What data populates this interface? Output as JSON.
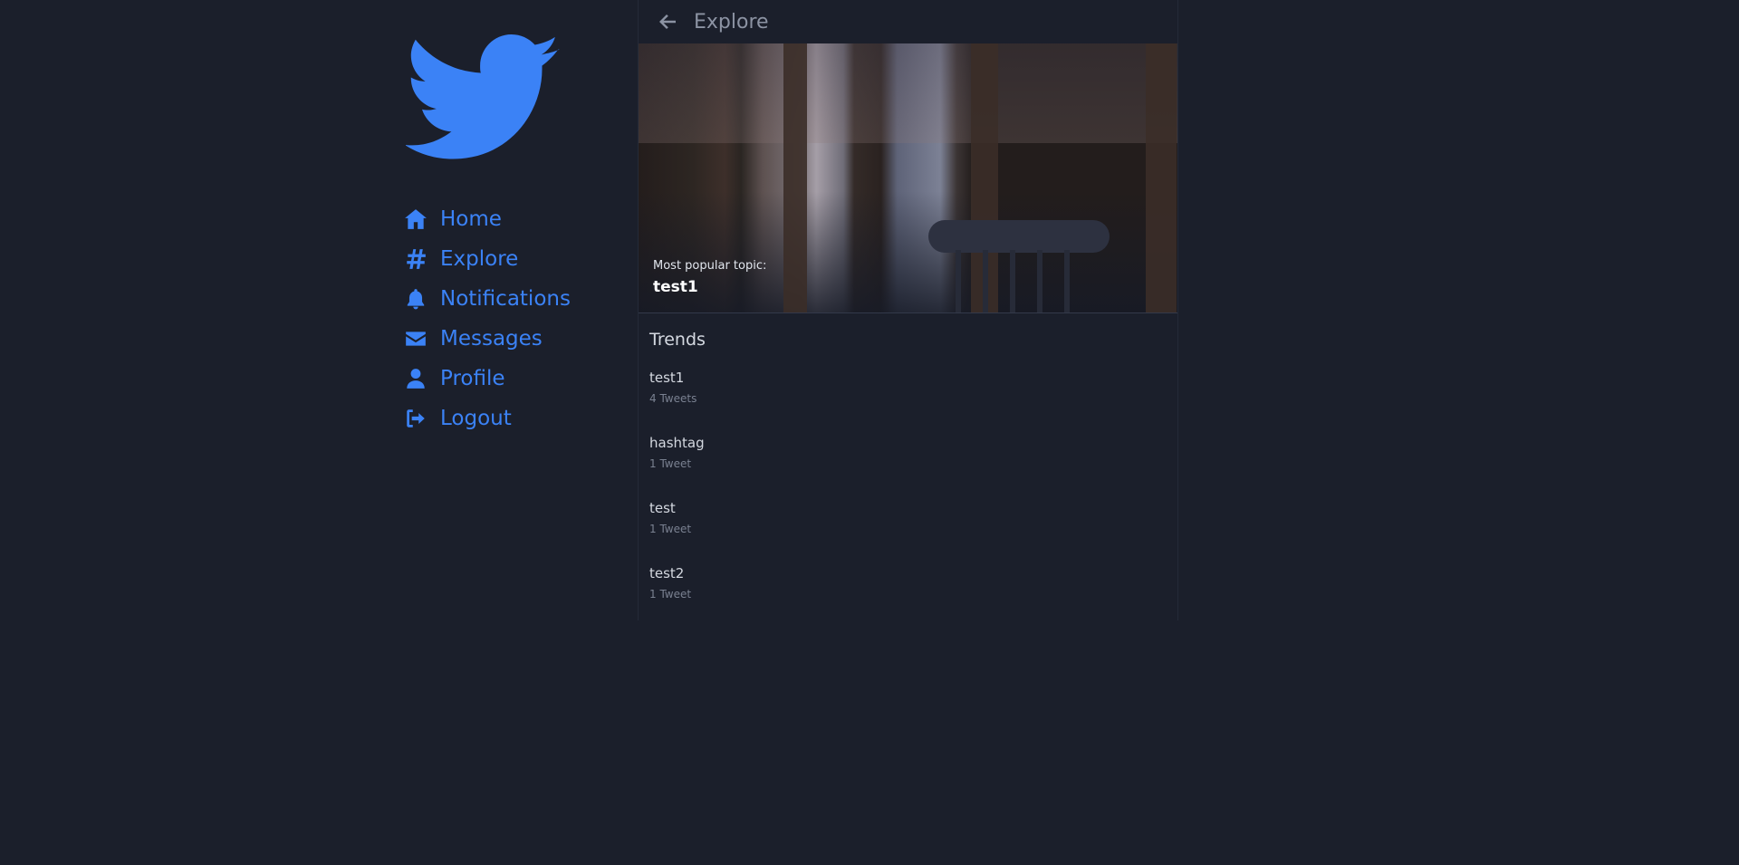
{
  "header": {
    "title": "Explore"
  },
  "sidebar": {
    "items": [
      {
        "label": "Home",
        "icon": "home-icon"
      },
      {
        "label": "Explore",
        "icon": "hashtag-icon"
      },
      {
        "label": "Notifications",
        "icon": "bell-icon"
      },
      {
        "label": "Messages",
        "icon": "envelope-icon"
      },
      {
        "label": "Profile",
        "icon": "user-icon"
      },
      {
        "label": "Logout",
        "icon": "logout-icon"
      }
    ]
  },
  "hero": {
    "label": "Most popular topic:",
    "topic": "test1"
  },
  "trends": {
    "title": "Trends",
    "items": [
      {
        "name": "test1",
        "count": "4 Tweets"
      },
      {
        "name": "hashtag",
        "count": "1 Tweet"
      },
      {
        "name": "test",
        "count": "1 Tweet"
      },
      {
        "name": "test2",
        "count": "1 Tweet"
      }
    ]
  },
  "colors": {
    "background": "#1b1f2b",
    "accent": "#3b82f6",
    "muted": "#8c93a3"
  }
}
